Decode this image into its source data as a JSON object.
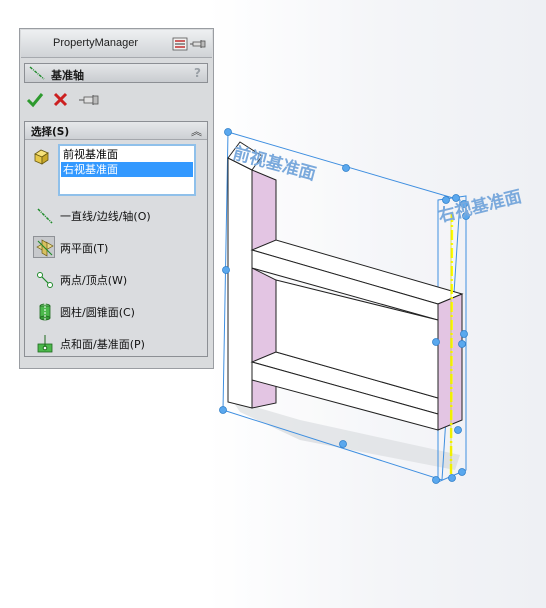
{
  "property_manager": {
    "title": "PropertyManager",
    "feature_name": "基准轴",
    "help": "?",
    "selections_group": {
      "title": "选择(S)",
      "selected_items": [
        "前视基准面",
        "右视基准面"
      ],
      "options": [
        {
          "label": "一直线/边线/轴(O)",
          "icon": "line-edge-axis-icon",
          "active": false
        },
        {
          "label": "两平面(T)",
          "icon": "two-planes-icon",
          "active": true
        },
        {
          "label": "两点/顶点(W)",
          "icon": "two-points-icon",
          "active": false
        },
        {
          "label": "圆柱/圆锥面(C)",
          "icon": "cylinder-icon",
          "active": false
        },
        {
          "label": "点和面/基准面(P)",
          "icon": "point-plane-icon",
          "active": false
        }
      ]
    }
  },
  "viewport": {
    "labels": {
      "front_plane": "前视基准面",
      "right_plane": "右视基准面"
    },
    "colors": {
      "plane_line": "#3f8fe0",
      "handle": "#5aa8ee",
      "axis": "#ffff00",
      "face_pink": "#e3c5e3"
    }
  }
}
